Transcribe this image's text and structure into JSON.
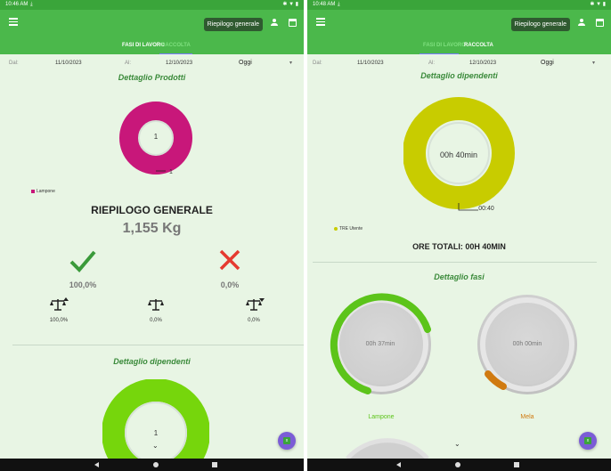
{
  "left": {
    "status": {
      "time": "10:46 AM"
    },
    "appbar": {
      "riepilogo_label": "Riepilogo generale"
    },
    "tabs": [
      {
        "label": "FASI DI LAVORO"
      },
      {
        "label": "RACCOLTA"
      }
    ],
    "filter": {
      "dal_label": "Dal:",
      "dal_value": "11/10/2023",
      "al_label": "Al:",
      "al_value": "12/10/2023",
      "period": "Oggi"
    },
    "prodotti": {
      "title": "Dettaglio Prodotti",
      "donut_center": "1",
      "donut_tick": "1",
      "legend": "Lampone",
      "legend_color": "#c8177a"
    },
    "riepilogo": {
      "title": "RIEPILOGO GENERALE",
      "kg": "1,155 Kg",
      "ok_pct": "100,0%",
      "ko_pct": "0,0%",
      "scale1": "100,0%",
      "scale2": "0,0%",
      "scale3": "0,0%"
    },
    "dipendenti": {
      "title": "Dettaglio dipendenti",
      "donut_center": "1"
    }
  },
  "right": {
    "status": {
      "time": "10:48 AM"
    },
    "appbar": {
      "riepilogo_label": "Riepilogo generale"
    },
    "tabs": [
      {
        "label": "FASI DI LAVORO"
      },
      {
        "label": "RACCOLTA"
      }
    ],
    "filter": {
      "dal_label": "Dal:",
      "dal_value": "11/10/2023",
      "al_label": "Al:",
      "al_value": "12/10/2023",
      "period": "Oggi"
    },
    "dipendenti": {
      "title": "Dettaglio dipendenti",
      "donut_center": "00h 40min",
      "donut_tick": "00:40",
      "legend": "TRE Utente",
      "legend_color": "#c8cc00"
    },
    "ore_totali": "ORE TOTALI: 00H 40MIN",
    "fasi": {
      "title": "Dettaglio fasi",
      "items": [
        {
          "label": "Lampone",
          "time": "00h 37min",
          "color": "#5cc41a",
          "progress": 0.42
        },
        {
          "label": "Mela",
          "time": "00h 00min",
          "color": "#d07a10",
          "progress": 0.08
        }
      ]
    }
  }
}
